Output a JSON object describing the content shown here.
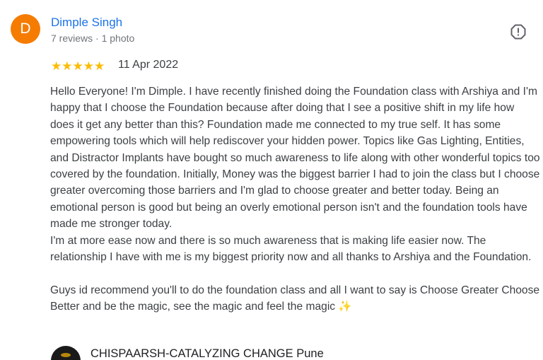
{
  "review": {
    "avatar_letter": "D",
    "avatar_color": "#f57c00",
    "author_name": "Dimple Singh",
    "author_meta": "7 reviews · 1 photo",
    "flag_icon": "alert-circle-icon",
    "rating_stars": 5,
    "star_glyph": "★",
    "date": "11 Apr 2022",
    "body_paragraph_1": "Hello Everyone! I'm Dimple. I have recently finished doing the Foundation class with Arshiya and I'm happy that I choose the Foundation because after doing that I see a positive shift in my life how does it get any better than this? Foundation made me connected to my true self. It has some empowering tools which will help rediscover your hidden power. Topics like Gas Lighting, Entities, and Distractor Implants have bought so much awareness to life along with other wonderful topics too covered by the foundation. Initially, Money was the biggest barrier I had to join the class but I choose greater overcoming those barriers and I'm glad to choose greater and better today. Being an emotional person is good but being an overly emotional person isn't and the foundation tools have made me stronger today.",
    "body_paragraph_1b": "I'm at more ease now and there is so much awareness that is making life easier now. The relationship I have with me is my biggest priority now and all thanks to Arshiya and the Foundation.",
    "body_paragraph_2": "Guys id recommend you'll to do the foundation class and all I want to say is Choose Greater Choose Better and be the magic, see the magic and feel the magic ✨"
  },
  "next_review": {
    "author_name": "CHISPAARSH-CATALYZING CHANGE Pune"
  },
  "colors": {
    "name_link": "#1a73e8",
    "star": "#fbbc04",
    "meta_text": "#70757a",
    "body_text": "#3c4043"
  }
}
